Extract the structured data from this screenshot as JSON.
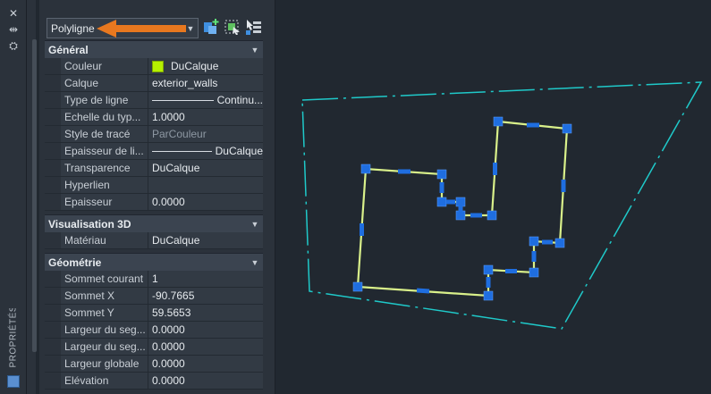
{
  "strip": {
    "close_glyph": "✕",
    "autohide_glyph": "⇹",
    "settings_glyph": "⛭",
    "vertical_label": "PROPRIÉTÉS"
  },
  "selector": {
    "value": "Polyligne",
    "caret": "▼"
  },
  "toolbar": {
    "icons": [
      "quick-select-icon",
      "select-objects-icon",
      "pickadd-toggle-icon"
    ]
  },
  "colors": {
    "accent_arrow": "#e8781f",
    "layer_color": "#b6f000",
    "grip_blue": "#1f6ee0",
    "boundary_cyan": "#1fc9c9"
  },
  "sections": [
    {
      "title": "Général",
      "rows": [
        {
          "key": "Couleur",
          "value": "DuCalque"
        },
        {
          "key": "Calque",
          "value": "exterior_walls"
        },
        {
          "key": "Type de ligne",
          "value": "Continu..."
        },
        {
          "key": "Echelle du typ...",
          "value": "1.0000"
        },
        {
          "key": "Style de tracé",
          "value": "ParCouleur"
        },
        {
          "key": "Epaisseur de li...",
          "value": "DuCalque"
        },
        {
          "key": "Transparence",
          "value": "DuCalque"
        },
        {
          "key": "Hyperlien",
          "value": ""
        },
        {
          "key": "Epaisseur",
          "value": "0.0000"
        }
      ]
    },
    {
      "title": "Visualisation 3D",
      "rows": [
        {
          "key": "Matériau",
          "value": "DuCalque"
        }
      ]
    },
    {
      "title": "Géométrie",
      "rows": [
        {
          "key": "Sommet courant",
          "value": "1"
        },
        {
          "key": "Sommet X",
          "value": "-90.7665"
        },
        {
          "key": "Sommet Y",
          "value": "59.5653"
        },
        {
          "key": "Largeur du seg...",
          "value": "0.0000"
        },
        {
          "key": "Largeur du seg...",
          "value": "0.0000"
        },
        {
          "key": "Largeur globale",
          "value": "0.0000"
        },
        {
          "key": "Elévation",
          "value": "0.0000"
        }
      ]
    }
  ]
}
